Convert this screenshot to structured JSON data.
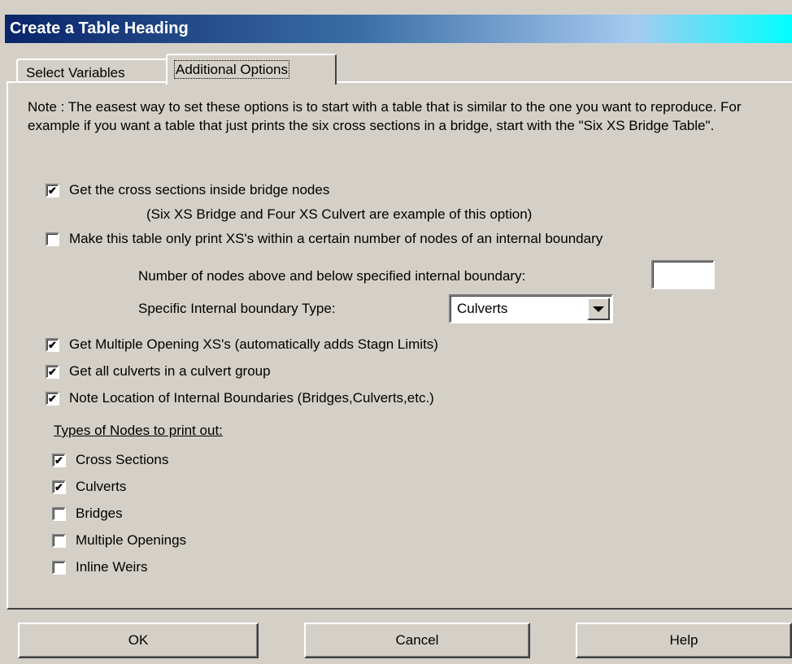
{
  "window": {
    "title": "Create a Table Heading"
  },
  "tabs": [
    {
      "label": "Select Variables"
    },
    {
      "label": "Additional Options"
    }
  ],
  "note": "Note : The easest way to set these options is to start with a table that is similar to the one you want to reproduce.  For example if you want a table that just prints the six cross sections in a bridge, start with the \"Six XS Bridge Table\".",
  "options": {
    "bridge_nodes": {
      "label": "Get the cross sections inside bridge nodes",
      "checked": true,
      "hint": "(Six XS Bridge and Four XS Culvert are example of this option)"
    },
    "internal_boundary": {
      "label": "Make this table only print XS's within a certain number of nodes of an internal boundary",
      "checked": false
    },
    "nodes_label": "Number of nodes above and below specified internal boundary:",
    "nodes_value": "",
    "type_label": "Specific Internal boundary Type:",
    "type_value": "Culverts",
    "multiple_opening": {
      "label": "Get Multiple Opening XS's (automatically adds Stagn Limits)",
      "checked": true
    },
    "culvert_group": {
      "label": "Get all culverts in a culvert group",
      "checked": true
    },
    "note_location": {
      "label": "Note Location of Internal Boundaries (Bridges,Culverts,etc.)",
      "checked": true
    }
  },
  "node_types": {
    "heading": "Types of Nodes to print out:",
    "items": [
      {
        "label": "Cross Sections",
        "checked": true
      },
      {
        "label": "Culverts",
        "checked": true
      },
      {
        "label": "Bridges",
        "checked": false
      },
      {
        "label": "Multiple Openings",
        "checked": false
      },
      {
        "label": "Inline Weirs",
        "checked": false
      }
    ]
  },
  "buttons": {
    "ok": "OK",
    "cancel": "Cancel",
    "help": "Help"
  }
}
